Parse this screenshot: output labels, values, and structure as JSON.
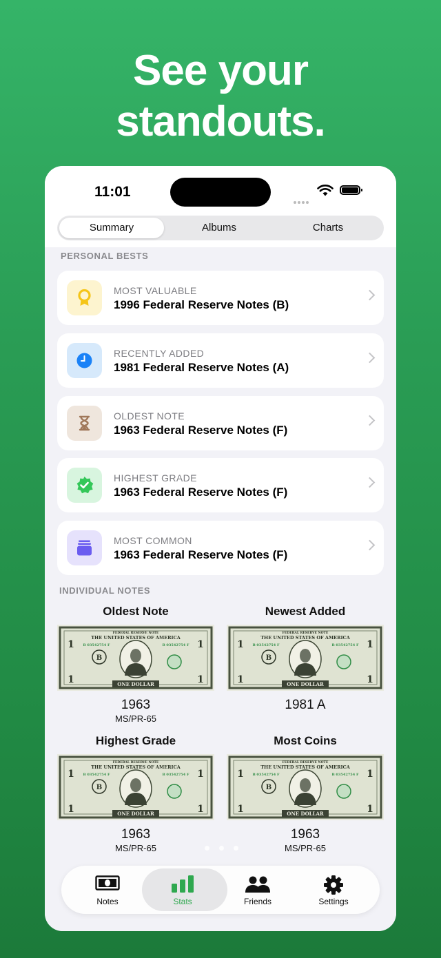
{
  "headline": {
    "line1": "See your",
    "line2": "standouts."
  },
  "status_bar": {
    "time": "11:01"
  },
  "segments": [
    {
      "label": "Summary"
    },
    {
      "label": "Albums"
    },
    {
      "label": "Charts"
    }
  ],
  "personal_bests": {
    "section_label": "PERSONAL BESTS",
    "items": [
      {
        "subtitle": "MOST VALUABLE",
        "title": "1996 Federal Reserve Notes (B)",
        "icon": "award-icon",
        "color": "#f5c518"
      },
      {
        "subtitle": "RECENTLY ADDED",
        "title": "1981 Federal Reserve Notes (A)",
        "icon": "clock-icon",
        "color": "#1a82f7"
      },
      {
        "subtitle": "OLDEST NOTE",
        "title": "1963 Federal Reserve Notes (F)",
        "icon": "hourglass-icon",
        "color": "#a0785a"
      },
      {
        "subtitle": "HIGHEST GRADE",
        "title": "1963 Federal Reserve Notes (F)",
        "icon": "verified-badge-icon",
        "color": "#34c759"
      },
      {
        "subtitle": "MOST COMMON",
        "title": "1963 Federal Reserve Notes (F)",
        "icon": "stack-icon",
        "color": "#6a5cf0"
      }
    ]
  },
  "individual_notes": {
    "section_label": "INDIVIDUAL NOTES",
    "items": [
      {
        "label": "Oldest Note",
        "year": "1963",
        "grade": "MS/PR-65"
      },
      {
        "label": "Newest Added",
        "year": "1981 A",
        "grade": ""
      },
      {
        "label": "Highest Grade",
        "year": "1963",
        "grade": "MS/PR-65"
      },
      {
        "label": "Most Coins",
        "year": "1963",
        "grade": "MS/PR-65"
      }
    ]
  },
  "bill": {
    "header": "FEDERAL RESERVE NOTE",
    "country": "THE UNITED STATES OF AMERICA",
    "serial": "B 03542754 F",
    "seal_letter": "B",
    "denomination": "ONE DOLLAR",
    "corner_value": "1"
  },
  "tabbar": {
    "active": "Stats",
    "items": [
      {
        "label": "Notes",
        "icon": "banknote-icon"
      },
      {
        "label": "Stats",
        "icon": "bar-chart-icon"
      },
      {
        "label": "Friends",
        "icon": "people-icon"
      },
      {
        "label": "Settings",
        "icon": "gear-icon"
      }
    ]
  },
  "colors": {
    "accent": "#2fa84f",
    "background_green": "#2a9d55"
  }
}
